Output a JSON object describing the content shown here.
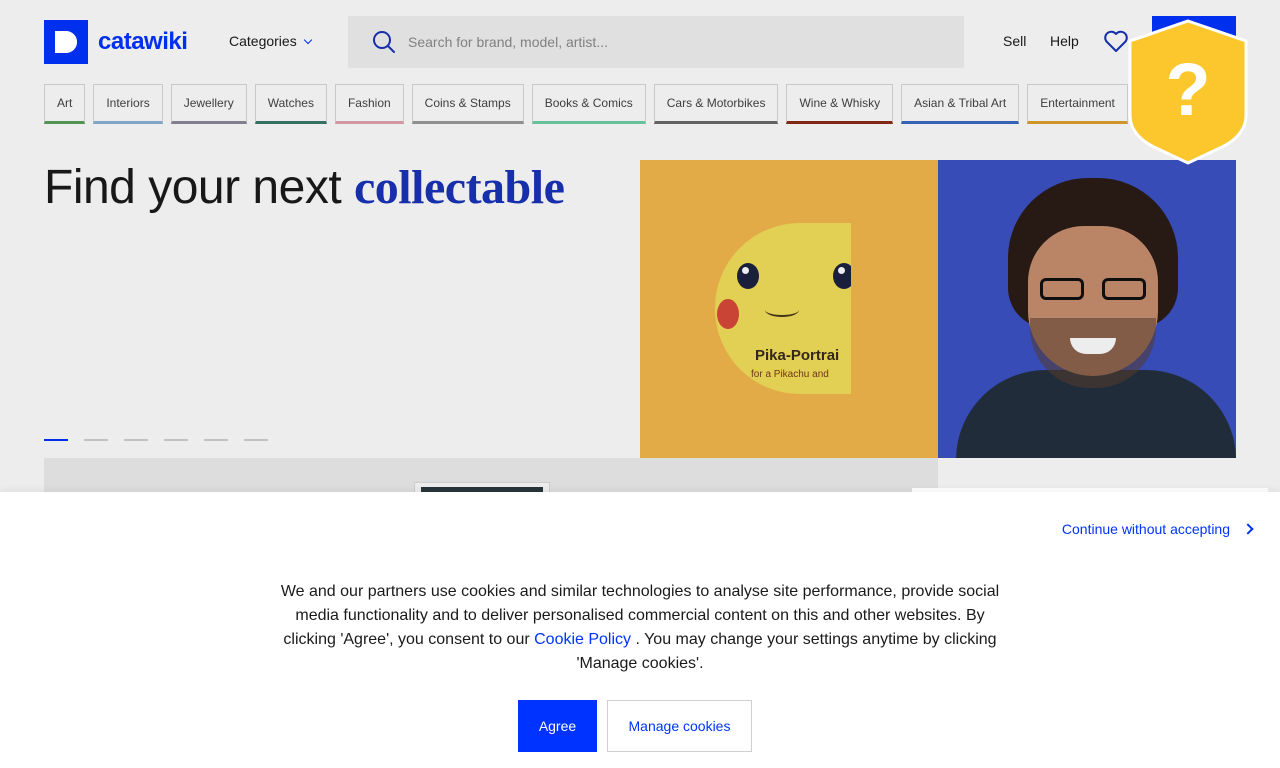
{
  "brand": {
    "name": "catawiki",
    "color": "#0033ff"
  },
  "header": {
    "categories_label": "Categories",
    "search_placeholder": "Search for brand, model, artist...",
    "sell_label": "Sell",
    "help_label": "Help",
    "favorites_icon": "heart-icon"
  },
  "category_tabs": [
    {
      "label": "Art",
      "color": "#5aa05a"
    },
    {
      "label": "Interiors",
      "color": "#8ab4d8"
    },
    {
      "label": "Jewellery",
      "color": "#8a8a9a"
    },
    {
      "label": "Watches",
      "color": "#3a7a6a"
    },
    {
      "label": "Fashion",
      "color": "#e3a3b0"
    },
    {
      "label": "Coins & Stamps",
      "color": "#9a9a9a"
    },
    {
      "label": "Books & Comics",
      "color": "#6fd1a8"
    },
    {
      "label": "Cars & Motorbikes",
      "color": "#6a6a6a"
    },
    {
      "label": "Wine & Whisky",
      "color": "#8a2a1a"
    },
    {
      "label": "Asian & Tribal Art",
      "color": "#3a6ac0"
    },
    {
      "label": "Entertainment",
      "color": "#e0a030"
    },
    {
      "label": "",
      "color": "#cccccc"
    }
  ],
  "hero": {
    "title_prefix": "Find your next ",
    "title_accent": "collectable",
    "slides_total": 6,
    "slide_active": 1,
    "card_caption": "Pika-Portrai",
    "card_subcaption": "for a Pikachu and"
  },
  "cookie": {
    "continue_label": "Continue without accepting",
    "text_before_link": "We and our partners use cookies and similar technologies to analyse site performance, provide social media functionality and to deliver personalised commercial content on this and other websites. By clicking 'Agree', you consent to our ",
    "link_label": "Cookie Policy",
    "text_after_link": " . You may change your settings anytime by clicking 'Manage cookies'.",
    "agree_label": "Agree",
    "manage_label": "Manage cookies"
  },
  "badge": {
    "icon": "question-shield-icon",
    "color": "#fcc72c"
  }
}
